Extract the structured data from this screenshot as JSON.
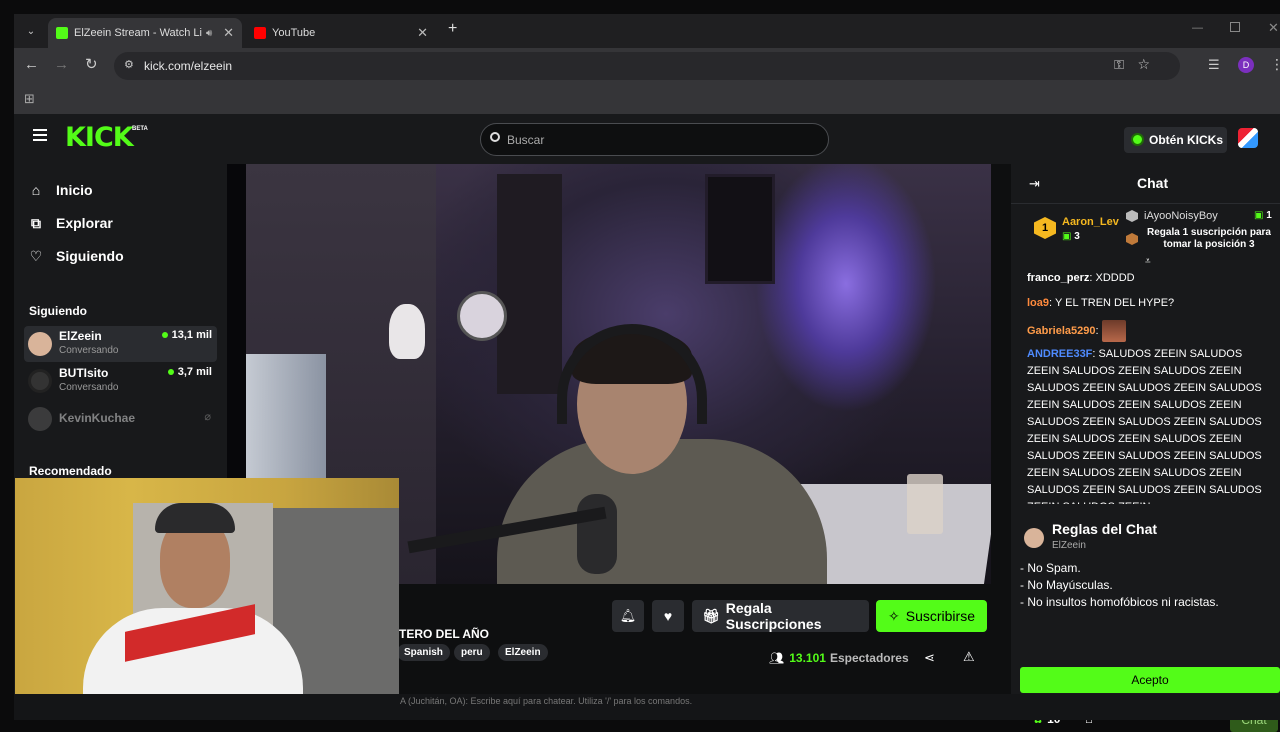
{
  "browser": {
    "tabs": [
      {
        "title": "ElZeein Stream - Watch Live",
        "active": true
      },
      {
        "title": "YouTube",
        "active": false
      }
    ],
    "url": "kick.com/elzeein",
    "profile_initial": "D"
  },
  "kick": {
    "logo": "KICK",
    "logo_badge": "BETA",
    "search_placeholder": "Buscar",
    "kicks_button": "Obtén KICKs",
    "nav": [
      {
        "label": "Inicio",
        "icon": "home-icon"
      },
      {
        "label": "Explorar",
        "icon": "explore-icon"
      },
      {
        "label": "Siguiendo",
        "icon": "heart-icon"
      }
    ],
    "following_title": "Siguiendo",
    "following": [
      {
        "name": "ElZeein",
        "sub": "Conversando",
        "viewers": "13,1 mil",
        "live": true
      },
      {
        "name": "BUTIsito",
        "sub": "Conversando",
        "viewers": "3,7 mil",
        "live": true
      },
      {
        "name": "KevinKuchae",
        "sub": "",
        "viewers": "",
        "live": false
      }
    ],
    "recommended_title": "Recomendado",
    "stream": {
      "title": "TERO DEL AÑO",
      "tags": [
        "Spanish",
        "peru",
        "ElZeein"
      ],
      "gift_button": "Regala Suscripciones",
      "subscribe_button": "Suscribirse",
      "viewers": "13.101",
      "viewers_label": "Espectadores"
    },
    "chat": {
      "title": "Chat",
      "leaderboard": {
        "top_user": "Aaron_Lev",
        "top_count": "3",
        "second_user": "iAyooNoisyBoy",
        "second_count": "1",
        "third_text": "Regala 1 suscripción para tomar la posición 3"
      },
      "messages": [
        {
          "user": "franco_perz",
          "text": "XDDDD",
          "color": "#ffffff"
        },
        {
          "user": "loa9",
          "text": "Y EL TREN DEL HYPE?",
          "color": "#ff8a3d"
        },
        {
          "user": "Gabriela5290",
          "text": "",
          "color": "#ff9c4a"
        },
        {
          "user": "ANDREE33F",
          "text": "SALUDOS ZEEIN SALUDOS ZEEIN SALUDOS ZEEIN SALUDOS ZEEIN SALUDOS ZEEIN SALUDOS ZEEIN SALUDOS ZEEIN SALUDOS ZEEIN SALUDOS ZEEIN SALUDOS ZEEIN SALUDOS ZEEIN SALUDOS ZEEIN SALUDOS ZEEIN SALUDOS ZEEIN SALUDOS ZEEIN SALUDOS ZEEIN SALUDOS ZEEIN SALUDOS ZEEIN SALUDOS ZEEIN SALUDOS ZEEIN SALUDOS ZEEIN SALUDOS ZEEIN SALUDOS ZEEIN",
          "color": "#4f8bff"
        }
      ],
      "rules_title": "Reglas del Chat",
      "rules_owner": "ElZeein",
      "rules": [
        "- No Spam.",
        "- No Mayúsculas.",
        "- No insultos homofóbicos ni racistas."
      ],
      "accept_button": "Acepto",
      "kicks_count": "10",
      "chat_button": "Chat",
      "input_placeholder": "A (Juchitán, OA): Escribe aquí para chatear. Utiliza '/' para los comandos."
    }
  },
  "colors": {
    "brand_green": "#53fc18",
    "bg": "#0e0f10",
    "panel": "#18191b"
  }
}
